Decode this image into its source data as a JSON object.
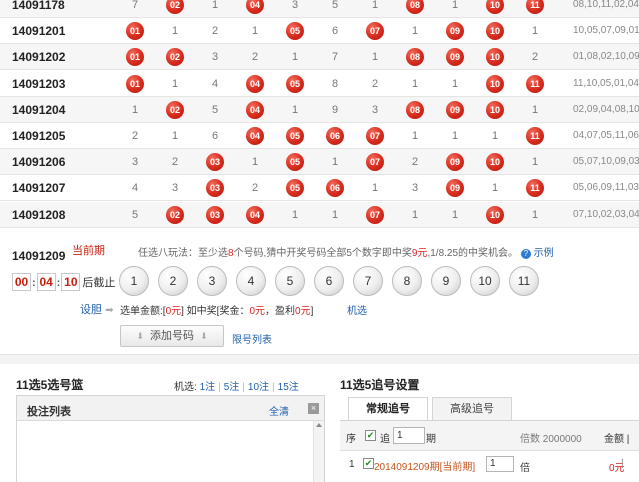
{
  "history": [
    {
      "issue": "14091178",
      "cells": [
        "7",
        "02",
        "1",
        "04",
        "3",
        "5",
        "1",
        "08",
        "1",
        "10",
        "11"
      ],
      "result": "08,10,11,02,04"
    },
    {
      "issue": "14091201",
      "cells": [
        "01",
        "1",
        "2",
        "1",
        "05",
        "6",
        "07",
        "1",
        "09",
        "10",
        "1"
      ],
      "result": "10,05,07,09,01"
    },
    {
      "issue": "14091202",
      "cells": [
        "01",
        "02",
        "3",
        "2",
        "1",
        "7",
        "1",
        "08",
        "09",
        "10",
        "2"
      ],
      "result": "01,08,02,10,09"
    },
    {
      "issue": "14091203",
      "cells": [
        "01",
        "1",
        "4",
        "04",
        "05",
        "8",
        "2",
        "1",
        "1",
        "10",
        "11"
      ],
      "result": "11,10,05,01,04"
    },
    {
      "issue": "14091204",
      "cells": [
        "1",
        "02",
        "5",
        "04",
        "1",
        "9",
        "3",
        "08",
        "09",
        "10",
        "1"
      ],
      "result": "02,09,04,08,10"
    },
    {
      "issue": "14091205",
      "cells": [
        "2",
        "1",
        "6",
        "04",
        "05",
        "06",
        "07",
        "1",
        "1",
        "1",
        "11"
      ],
      "result": "04,07,05,11,06"
    },
    {
      "issue": "14091206",
      "cells": [
        "3",
        "2",
        "03",
        "1",
        "05",
        "1",
        "07",
        "2",
        "09",
        "10",
        "1"
      ],
      "result": "05,07,10,09,03"
    },
    {
      "issue": "14091207",
      "cells": [
        "4",
        "3",
        "03",
        "2",
        "05",
        "06",
        "1",
        "3",
        "09",
        "1",
        "11"
      ],
      "result": "05,06,09,11,03"
    },
    {
      "issue": "14091208",
      "cells": [
        "5",
        "02",
        "03",
        "04",
        "1",
        "1",
        "07",
        "1",
        "1",
        "10",
        "1"
      ],
      "result": "07,10,02,03,04"
    }
  ],
  "current": {
    "issue": "14091209",
    "tag": "当前期",
    "rule_prefix": "任选八玩法：至少选",
    "rule_count": "8",
    "rule_mid": "个号码,猜中开奖号码全部5个数字即中奖",
    "rule_prize": "9元",
    "rule_suffix": ",1/8.25的中奖机会。",
    "help_icon": "?",
    "example_label": "示例",
    "countdown": {
      "h": "00",
      "m": "04",
      "s": "10",
      "suffix": "后截止"
    },
    "numbers": [
      "1",
      "2",
      "3",
      "4",
      "5",
      "6",
      "7",
      "8",
      "9",
      "10",
      "11"
    ],
    "settings_label": "设胆",
    "settings_arrow": "➡",
    "summary_prefix": "选单金额:[",
    "summary_amount": "0元",
    "summary_mid": "] 如中奖[奖金：",
    "summary_prize": "0元",
    "summary_mid2": "，盈利",
    "summary_profit": "0元",
    "summary_suffix": "]",
    "machine_label": "机选",
    "add_label": "添加号码",
    "add_arrow_left": "⬇",
    "add_arrow_right": "⬇",
    "limit_label": "限号列表"
  },
  "basket": {
    "title": "11选5选号篮",
    "machine_prefix": "机选:",
    "options": [
      "1注",
      "5注",
      "10注",
      "15注"
    ],
    "list_title": "投注列表",
    "clear_label": "全清",
    "close_icon": "×"
  },
  "tracking": {
    "title": "11选5追号设置",
    "tabs": [
      "常规追号",
      "高级追号"
    ],
    "seq_label": "序",
    "check_mark": "✔",
    "chase_label": "追",
    "period_input": "1",
    "period_label": "期",
    "mult_header": "倍数 2000000",
    "amount_header": "金额 |",
    "row": {
      "idx": "1",
      "issue": "2014091209期[当前期]",
      "input": "1",
      "mult": "倍",
      "amount": "0元",
      "pipe": "|"
    }
  },
  "colors": {
    "red_ball": "#d62a1c",
    "link": "#1f5fae",
    "accent_red": "#c81e0e"
  }
}
